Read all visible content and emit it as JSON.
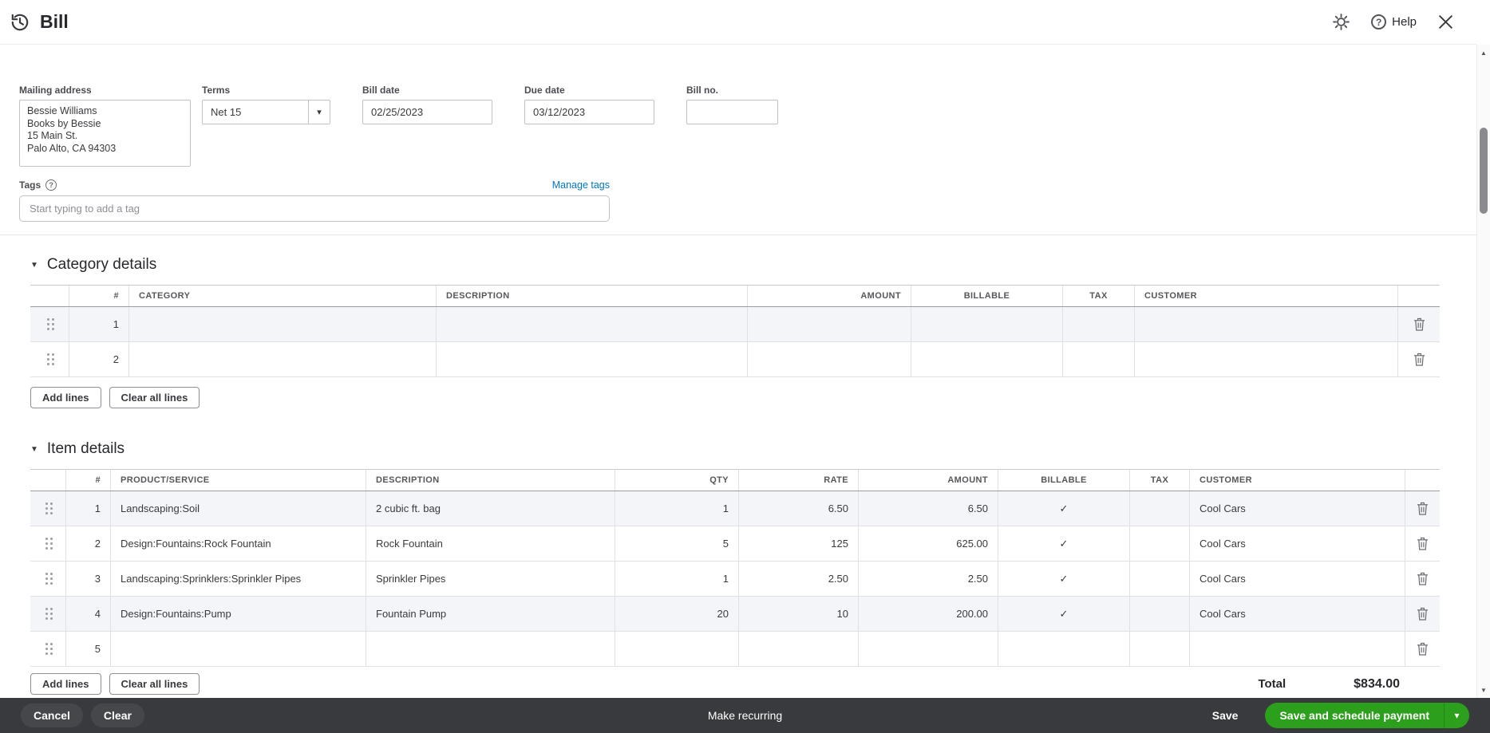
{
  "colors": {
    "accent_green": "#2ca01c",
    "link_blue": "#0077c5",
    "footer_bg": "#393a3d",
    "check_green": "#1d9f26"
  },
  "icons": {
    "triangle_down": "▼",
    "dropdown_caret": "▾",
    "scroll_up": "▲",
    "scroll_down": "▼",
    "check": "✓",
    "question_mark": "?"
  },
  "header": {
    "title": "Bill",
    "help_label": "Help"
  },
  "form": {
    "mailing_address": {
      "label": "Mailing address",
      "value": "Bessie Williams\nBooks by Bessie\n15 Main St.\nPalo Alto, CA  94303"
    },
    "terms": {
      "label": "Terms",
      "value": "Net 15"
    },
    "bill_date": {
      "label": "Bill date",
      "value": "02/25/2023"
    },
    "due_date": {
      "label": "Due date",
      "value": "03/12/2023"
    },
    "bill_no": {
      "label": "Bill no.",
      "value": ""
    },
    "tags": {
      "label": "Tags",
      "manage_link": "Manage tags",
      "placeholder": "Start typing to add a tag"
    }
  },
  "category_details": {
    "title": "Category details",
    "columns": [
      "#",
      "CATEGORY",
      "DESCRIPTION",
      "AMOUNT",
      "BILLABLE",
      "TAX",
      "CUSTOMER"
    ],
    "rows": [
      {
        "num": "1"
      },
      {
        "num": "2"
      }
    ],
    "add_lines_label": "Add lines",
    "clear_all_label": "Clear all lines"
  },
  "item_details": {
    "title": "Item details",
    "columns": [
      "#",
      "PRODUCT/SERVICE",
      "DESCRIPTION",
      "QTY",
      "RATE",
      "AMOUNT",
      "BILLABLE",
      "TAX",
      "CUSTOMER"
    ],
    "rows": [
      {
        "num": "1",
        "product": "Landscaping:Soil",
        "description": "2 cubic ft. bag",
        "qty": "1",
        "rate": "6.50",
        "amount": "6.50",
        "billable": "✓",
        "customer": "Cool Cars"
      },
      {
        "num": "2",
        "product": "Design:Fountains:Rock Fountain",
        "description": "Rock Fountain",
        "qty": "5",
        "rate": "125",
        "amount": "625.00",
        "billable": "✓",
        "customer": "Cool Cars"
      },
      {
        "num": "3",
        "product": "Landscaping:Sprinklers:Sprinkler Pipes",
        "description": "Sprinkler Pipes",
        "qty": "1",
        "rate": "2.50",
        "amount": "2.50",
        "billable": "✓",
        "customer": "Cool Cars"
      },
      {
        "num": "4",
        "product": "Design:Fountains:Pump",
        "description": "Fountain Pump",
        "qty": "20",
        "rate": "10",
        "amount": "200.00",
        "billable": "✓",
        "customer": "Cool Cars"
      },
      {
        "num": "5",
        "product": "",
        "description": "",
        "qty": "",
        "rate": "",
        "amount": "",
        "billable": "",
        "customer": ""
      }
    ],
    "add_lines_label": "Add lines",
    "clear_all_label": "Clear all lines"
  },
  "totals": {
    "label": "Total",
    "amount": "$834.00"
  },
  "footer": {
    "cancel_label": "Cancel",
    "clear_label": "Clear",
    "make_recurring_label": "Make recurring",
    "save_label": "Save",
    "save_schedule_label": "Save and schedule payment"
  }
}
